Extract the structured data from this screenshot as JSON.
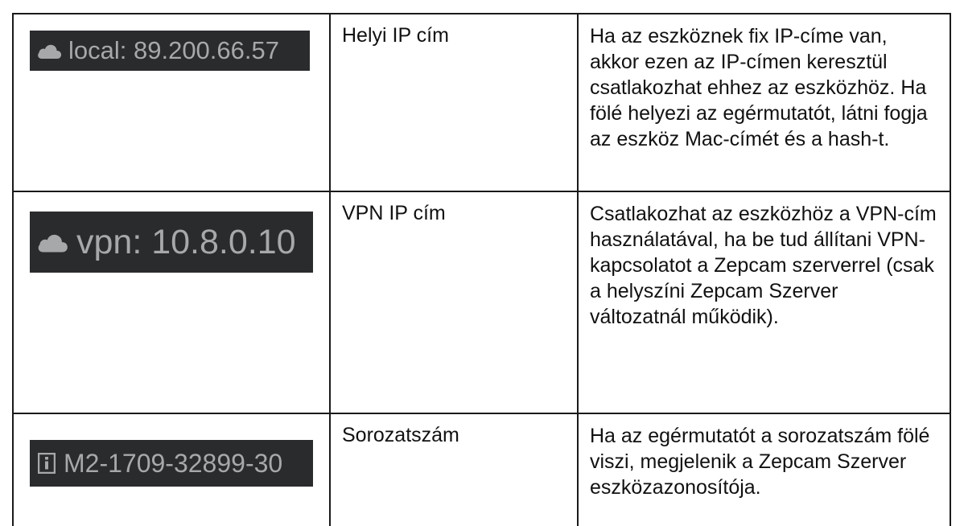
{
  "rows": [
    {
      "chip": {
        "icon": "cloud-icon",
        "label": "local: 89.200.66.57"
      },
      "name": "Helyi IP cím",
      "description": "Ha az eszköznek fix IP-címe van, akkor ezen az IP-címen keresztül csatlakozhat ehhez az eszközhöz. Ha fölé helyezi az egérmutatót, látni fogja az eszköz Mac-címét és a hash-t."
    },
    {
      "chip": {
        "icon": "cloud-icon",
        "label": "vpn: 10.8.0.10"
      },
      "name": "VPN IP cím",
      "description": "Csatlakozhat az eszközhöz a VPN-cím használatával, ha be tud állítani VPN-kapcsolatot a Zepcam szerverrel (csak a helyszíni Zepcam Szerver változatnál működik)."
    },
    {
      "chip": {
        "icon": "info-icon",
        "label": "M2-1709-32899-30"
      },
      "name": "Sorozatszám",
      "description": "Ha az egérmutatót a sorozatszám fölé viszi, megjelenik a Zepcam Szerver eszközazonosítója."
    }
  ],
  "colors": {
    "chip_background": "#2a2b2d",
    "chip_text": "#a7a8aa",
    "border": "#1a1a1a"
  }
}
